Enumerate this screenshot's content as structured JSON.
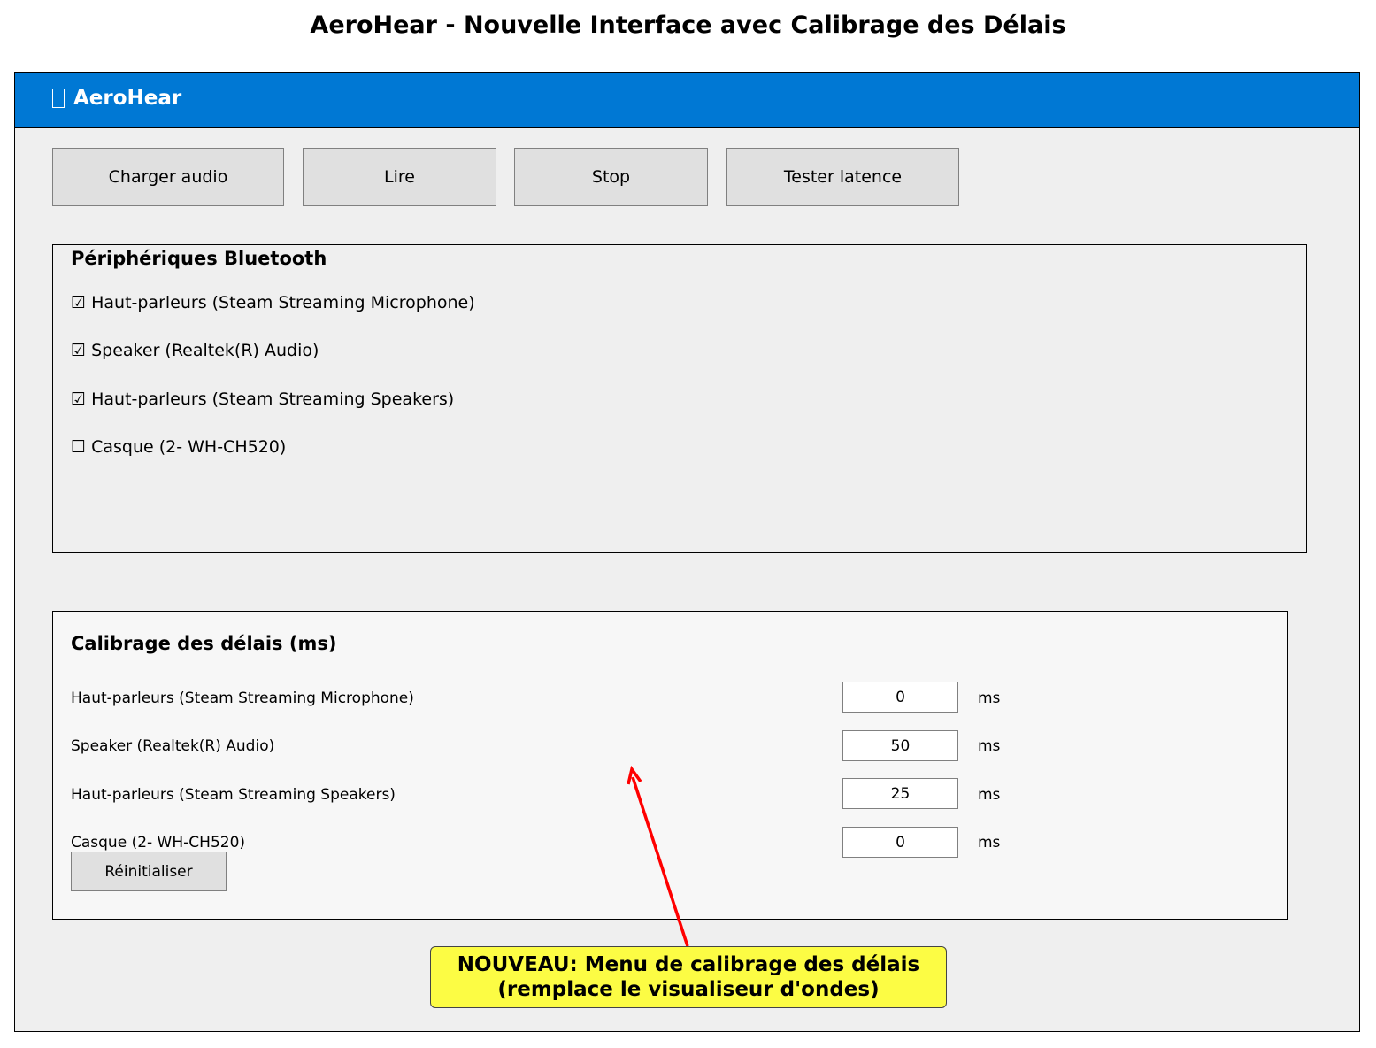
{
  "figure": {
    "title": "AeroHear - Nouvelle Interface avec Calibrage des Délais"
  },
  "window": {
    "title": "AeroHear",
    "icon": "speaker-icon",
    "accent_color": "#0078d4"
  },
  "toolbar": {
    "load_label": "Charger audio",
    "play_label": "Lire",
    "stop_label": "Stop",
    "latency_label": "Tester latence"
  },
  "bluetooth": {
    "title": "Périphériques Bluetooth",
    "devices": [
      {
        "checkbox": "☑",
        "label": "Haut-parleurs (Steam Streaming Microphone)",
        "checked": true
      },
      {
        "checkbox": "☑",
        "label": "Speaker (Realtek(R) Audio)",
        "checked": true
      },
      {
        "checkbox": "☑",
        "label": "Haut-parleurs (Steam Streaming Speakers)",
        "checked": true
      },
      {
        "checkbox": "☐",
        "label": "Casque (2- WH-CH520)",
        "checked": false
      }
    ]
  },
  "calibration": {
    "title": "Calibrage des délais (ms)",
    "rows": [
      {
        "label": "Haut-parleurs (Steam Streaming Microphone)",
        "value": "0",
        "unit": "ms"
      },
      {
        "label": "Speaker (Realtek(R) Audio)",
        "value": "50",
        "unit": "ms"
      },
      {
        "label": "Haut-parleurs (Steam Streaming Speakers)",
        "value": "25",
        "unit": "ms"
      },
      {
        "label": "Casque (2- WH-CH520)",
        "value": "0",
        "unit": "ms"
      }
    ],
    "reset_label": "Réinitialiser"
  },
  "callout": {
    "line1": "NOUVEAU: Menu de calibrage des délais",
    "line2": "(remplace le visualiseur d'ondes)",
    "background_color": "#fcfc44",
    "arrow_color": "#ff0000"
  }
}
